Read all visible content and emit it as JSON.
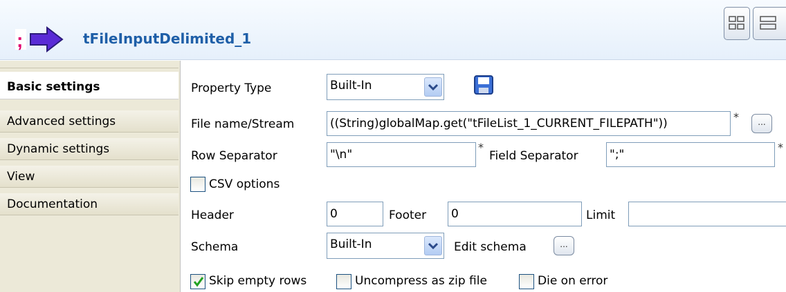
{
  "header": {
    "title": "tFileInputDelimited_1",
    "component_icon": "arrow-delimited-icon",
    "view_icons": [
      "layout-grid-icon",
      "layout-list-icon"
    ]
  },
  "sidebar": {
    "tabs": [
      {
        "label": "Basic settings",
        "active": true
      },
      {
        "label": "Advanced settings",
        "active": false
      },
      {
        "label": "Dynamic settings",
        "active": false
      },
      {
        "label": "View",
        "active": false
      },
      {
        "label": "Documentation",
        "active": false
      }
    ]
  },
  "form": {
    "property_type_label": "Property Type",
    "property_type_value": "Built-In",
    "save_icon": "floppy-disk-icon",
    "file_name_label": "File name/Stream",
    "file_name_value": "((String)globalMap.get(\"tFileList_1_CURRENT_FILEPATH\"))",
    "required_mark": "*",
    "browse_label": "...",
    "row_sep_label": "Row Separator",
    "row_sep_value": "\"\\n\"",
    "field_sep_label": "Field Separator",
    "field_sep_value": "\";\"",
    "csv_options_label": "CSV options",
    "header_label": "Header",
    "header_value": "0",
    "footer_label": "Footer",
    "footer_value": "0",
    "limit_label": "Limit",
    "limit_value": "",
    "schema_label": "Schema",
    "schema_value": "Built-In",
    "edit_schema_label": "Edit schema",
    "skip_empty_label": "Skip empty rows",
    "uncompress_label": "Uncompress as zip file",
    "die_on_error_label": "Die on error"
  },
  "colors": {
    "title": "#1f5fa8",
    "header_bg": "#e6f0fb",
    "sidebar_bg": "#ece9d8",
    "input_border": "#7f9db9",
    "checkbox_border": "#1c5180",
    "check_green": "#21a121"
  }
}
